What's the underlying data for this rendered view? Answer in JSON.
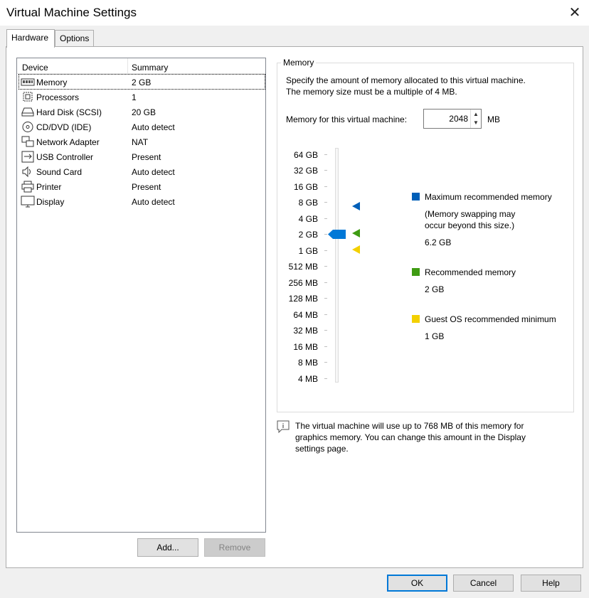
{
  "window": {
    "title": "Virtual Machine Settings",
    "close": "✕"
  },
  "tabs": [
    {
      "label": "Hardware"
    },
    {
      "label": "Options"
    }
  ],
  "device_list": {
    "columns": {
      "device": "Device",
      "summary": "Summary"
    },
    "rows": [
      {
        "name": "Memory",
        "summary": "2 GB",
        "icon": "memory-icon"
      },
      {
        "name": "Processors",
        "summary": "1",
        "icon": "processor-icon"
      },
      {
        "name": "Hard Disk (SCSI)",
        "summary": "20 GB",
        "icon": "hard-disk-icon"
      },
      {
        "name": "CD/DVD (IDE)",
        "summary": "Auto detect",
        "icon": "cd-dvd-icon"
      },
      {
        "name": "Network Adapter",
        "summary": "NAT",
        "icon": "network-adapter-icon"
      },
      {
        "name": "USB Controller",
        "summary": "Present",
        "icon": "usb-icon"
      },
      {
        "name": "Sound Card",
        "summary": "Auto detect",
        "icon": "speaker-icon"
      },
      {
        "name": "Printer",
        "summary": "Present",
        "icon": "printer-icon"
      },
      {
        "name": "Display",
        "summary": "Auto detect",
        "icon": "monitor-icon"
      }
    ]
  },
  "buttons": {
    "add": "Add...",
    "remove": "Remove",
    "ok": "OK",
    "cancel": "Cancel",
    "help": "Help"
  },
  "memory": {
    "group_label": "Memory",
    "description_line1": "Specify the amount of memory allocated to this virtual machine.",
    "description_line2": "The memory size must be a multiple of 4 MB.",
    "field_label": "Memory for this virtual machine:",
    "value": "2048",
    "unit": "MB",
    "scale": [
      "64 GB",
      "32 GB",
      "16 GB",
      "8 GB",
      "4 GB",
      "2 GB",
      "1 GB",
      "512 MB",
      "256 MB",
      "128 MB",
      "64 MB",
      "32 MB",
      "16 MB",
      "8 MB",
      "4 MB"
    ],
    "slider_level": "2 GB",
    "legend": {
      "max_title": "Maximum recommended memory",
      "max_note_line1": "(Memory swapping may",
      "max_note_line2": "occur beyond this size.)",
      "max_value": "6.2 GB",
      "rec_title": "Recommended memory",
      "rec_value": "2 GB",
      "min_title": "Guest OS recommended minimum",
      "min_value": "1 GB"
    },
    "colors": {
      "max": "#005fb8",
      "recommended": "#3f9b13",
      "minimum": "#f3d000",
      "slider": "#0078d7"
    },
    "info_line1": "The virtual machine will use up to 768 MB of this memory for",
    "info_line2": "graphics memory. You can change this amount in the Display",
    "info_line3": "settings page."
  }
}
